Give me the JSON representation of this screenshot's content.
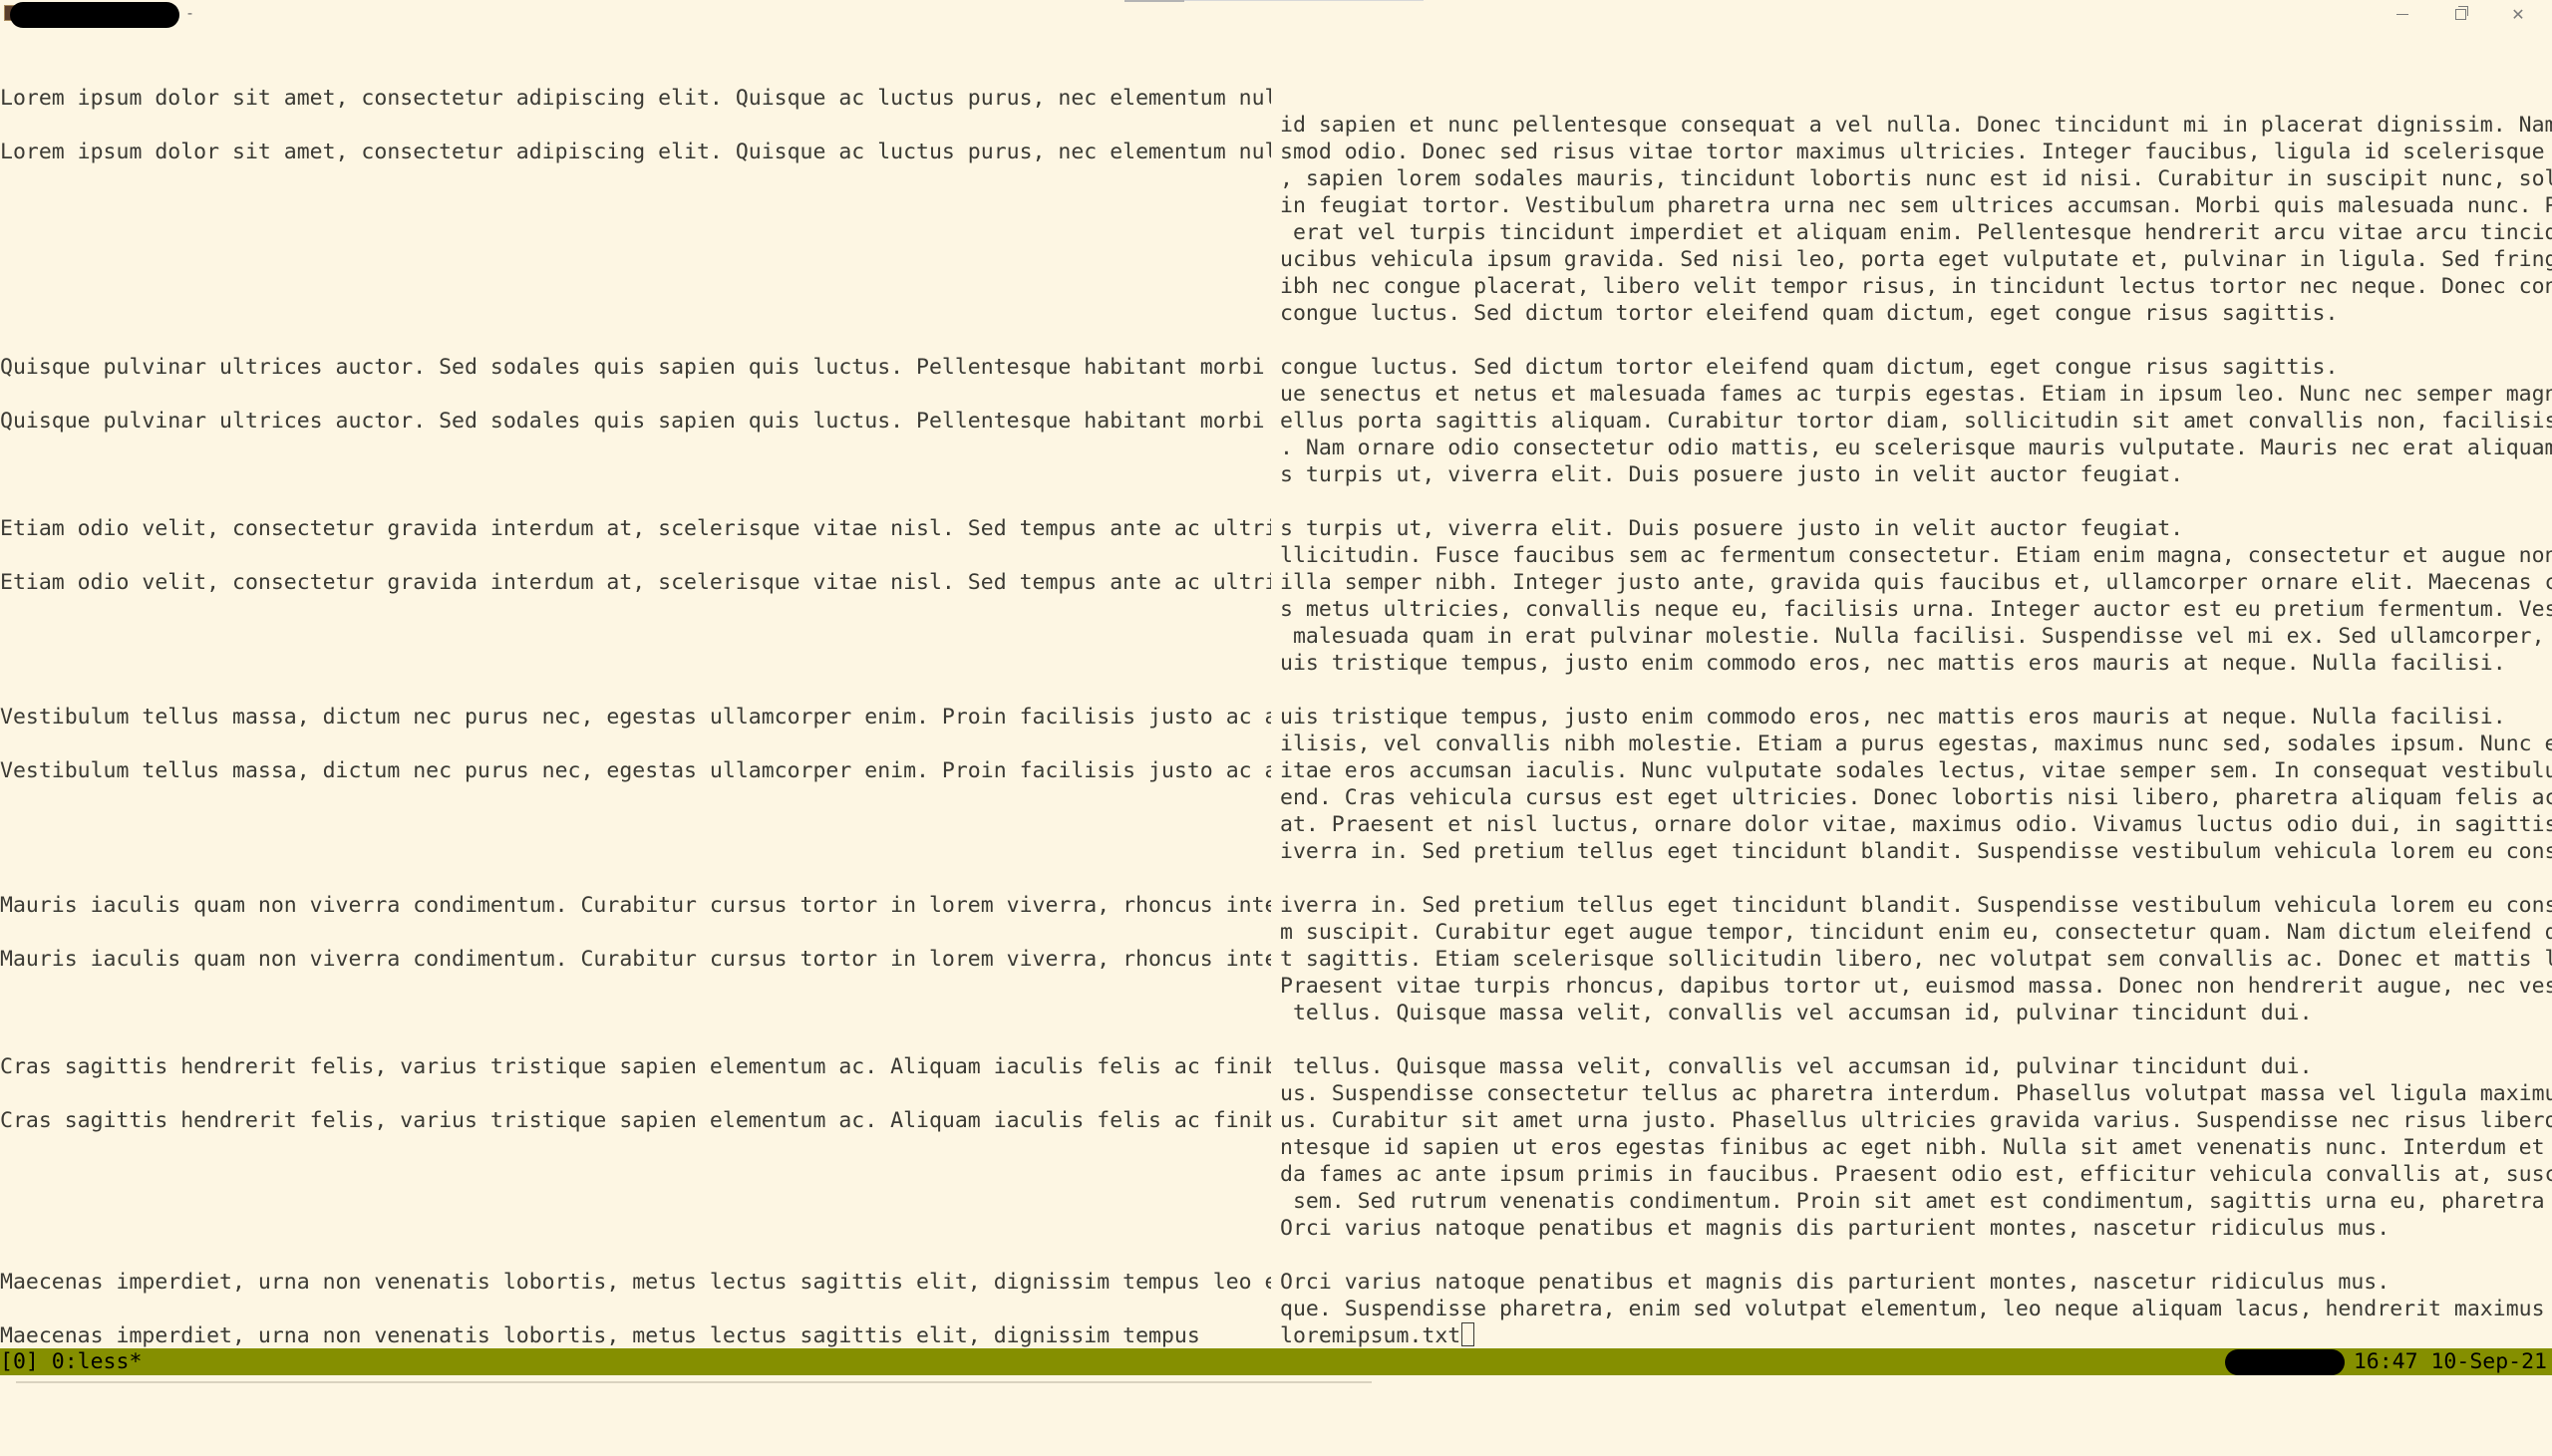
{
  "window": {
    "title_suffix": "-",
    "controls": {
      "minimize_icon": "minimize-icon",
      "maximize_icon": "restore-icon",
      "close_icon": "close-icon",
      "close_glyph": "✕"
    }
  },
  "left_pane": {
    "lines": [
      "Lorem ipsum dolor sit amet, consectetur adipiscing elit. Quisque ac luctus purus, nec elementum nulla. Ut",
      "",
      "Lorem ipsum dolor sit amet, consectetur adipiscing elit. Quisque ac luctus purus, nec elementum nulla. Ut",
      "",
      "",
      "",
      "",
      "",
      "",
      "",
      "Quisque pulvinar ultrices auctor. Sed sodales quis sapien quis luctus. Pellentesque habitant morbi tristiq",
      "",
      "Quisque pulvinar ultrices auctor. Sed sodales quis sapien quis luctus. Pellentesque habitant morbi tristiq",
      "",
      "",
      "",
      "Etiam odio velit, consectetur gravida interdum at, scelerisque vitae nisl. Sed tempus ante ac ultricies so",
      "",
      "Etiam odio velit, consectetur gravida interdum at, scelerisque vitae nisl. Sed tempus ante ac ultricies so",
      "",
      "",
      "",
      "",
      "Vestibulum tellus massa, dictum nec purus nec, egestas ullamcorper enim. Proin facilisis justo ac ante fac",
      "",
      "Vestibulum tellus massa, dictum nec purus nec, egestas ullamcorper enim. Proin facilisis justo ac ante fac",
      "",
      "",
      "",
      "",
      "Mauris iaculis quam non viverra condimentum. Curabitur cursus tortor in lorem viverra, rhoncus interdum se",
      "",
      "Mauris iaculis quam non viverra condimentum. Curabitur cursus tortor in lorem viverra, rhoncus interdum se",
      "",
      "",
      "",
      "Cras sagittis hendrerit felis, varius tristique sapien elementum ac. Aliquam iaculis felis ac finibus temp",
      "",
      "Cras sagittis hendrerit felis, varius tristique sapien elementum ac. Aliquam iaculis felis ac finibus temp",
      "",
      "",
      "",
      "",
      "",
      "Maecenas imperdiet, urna non venenatis lobortis, metus lectus sagittis elit, dignissim tempus leo ex at ne",
      "",
      "Maecenas imperdiet, urna non venenatis lobortis, metus lectus sagittis elit, dignissim tempus"
    ]
  },
  "right_pane": {
    "lines": [
      "",
      "id sapien et nunc pellentesque consequat a vel nulla. Donec tincidunt mi in placerat dignissim. Nam eu eui",
      "smod odio. Donec sed risus vitae tortor maximus ultricies. Integer faucibus, ligula id scelerisque blandit",
      ", sapien lorem sodales mauris, tincidunt lobortis nunc est id nisi. Curabitur in suscipit nunc, sollicitud",
      "in feugiat tortor. Vestibulum pharetra urna nec sem ultrices accumsan. Morbi quis malesuada nunc. Proin id",
      " erat vel turpis tincidunt imperdiet et aliquam enim. Pellentesque hendrerit arcu vitae arcu tincidunt, fa",
      "ucibus vehicula ipsum gravida. Sed nisi leo, porta eget vulputate et, pulvinar in ligula. Sed fringilla, n",
      "ibh nec congue placerat, libero velit tempor risus, in tincidunt lectus tortor nec neque. Donec convallis",
      "congue luctus. Sed dictum tortor eleifend quam dictum, eget congue risus sagittis.",
      "",
      "congue luctus. Sed dictum tortor eleifend quam dictum, eget congue risus sagittis.",
      "ue senectus et netus et malesuada fames ac turpis egestas. Etiam in ipsum leo. Nunc nec semper magna. Phas",
      "ellus porta sagittis aliquam. Curabitur tortor diam, sollicitudin sit amet convallis non, facilisis a diam",
      ". Nam ornare odio consectetur odio mattis, eu scelerisque mauris vulputate. Mauris nec erat aliquam, luctu",
      "s turpis ut, viverra elit. Duis posuere justo in velit auctor feugiat.",
      "",
      "s turpis ut, viverra elit. Duis posuere justo in velit auctor feugiat.",
      "llicitudin. Fusce faucibus sem ac fermentum consectetur. Etiam enim magna, consectetur et augue non, fring",
      "illa semper nibh. Integer justo ante, gravida quis faucibus et, ullamcorper ornare elit. Maecenas convalli",
      "s metus ultricies, convallis neque eu, facilisis urna. Integer auctor est eu pretium fermentum. Vestibulum",
      " malesuada quam in erat pulvinar molestie. Nulla facilisi. Suspendisse vel mi ex. Sed ullamcorper, massa q",
      "uis tristique tempus, justo enim commodo eros, nec mattis eros mauris at neque. Nulla facilisi.",
      "",
      "uis tristique tempus, justo enim commodo eros, nec mattis eros mauris at neque. Nulla facilisi.",
      "ilisis, vel convallis nibh molestie. Etiam a purus egestas, maximus nunc sed, sodales ipsum. Nunc eu leo v",
      "itae eros accumsan iaculis. Nunc vulputate sodales lectus, vitae semper sem. In consequat vestibulum eleif",
      "end. Cras vehicula cursus est eget ultricies. Donec lobortis nisi libero, pharetra aliquam felis accumsan",
      "at. Praesent et nisl luctus, ornare dolor vitae, maximus odio. Vivamus luctus odio dui, in sagittis nibh v",
      "iverra in. Sed pretium tellus eget tincidunt blandit. Suspendisse vestibulum vehicula lorem eu consequat.",
      "",
      "iverra in. Sed pretium tellus eget tincidunt blandit. Suspendisse vestibulum vehicula lorem eu consequat.",
      "m suscipit. Curabitur eget augue tempor, tincidunt enim eu, consectetur quam. Nam dictum eleifend quam ege",
      "t sagittis. Etiam scelerisque sollicitudin libero, nec volutpat sem convallis ac. Donec et mattis lectus.",
      "Praesent vitae turpis rhoncus, dapibus tortor ut, euismod massa. Donec non hendrerit augue, nec vestibulum",
      " tellus. Quisque massa velit, convallis vel accumsan id, pulvinar tincidunt dui.",
      "",
      " tellus. Quisque massa velit, convallis vel accumsan id, pulvinar tincidunt dui.",
      "us. Suspendisse consectetur tellus ac pharetra interdum. Phasellus volutpat massa vel ligula maximus maxim",
      "us. Curabitur sit amet urna justo. Phasellus ultricies gravida varius. Suspendisse nec risus libero. Pelle",
      "ntesque id sapien ut eros egestas finibus ac eget nibh. Nulla sit amet venenatis nunc. Interdum et malesua",
      "da fames ac ante ipsum primis in faucibus. Praesent odio est, efficitur vehicula convallis at, suscipit at",
      " sem. Sed rutrum venenatis condimentum. Proin sit amet est condimentum, sagittis urna eu, pharetra ipsum.",
      "Orci varius natoque penatibus et magnis dis parturient montes, nascetur ridiculus mus.",
      "",
      "Orci varius natoque penatibus et magnis dis parturient montes, nascetur ridiculus mus.",
      "que. Suspendisse pharetra, enim sed volutpat elementum, leo neque aliquam lacus, hendrerit maximus dui aug"
    ],
    "prompt_file": "loremipsum.txt"
  },
  "status_bar": {
    "left": "[0] 0:less*",
    "right": "\" 16:47 10-Sep-21",
    "color": "#858f00"
  },
  "colors": {
    "background": "#fdf6e3",
    "text": "#3b3a34"
  }
}
